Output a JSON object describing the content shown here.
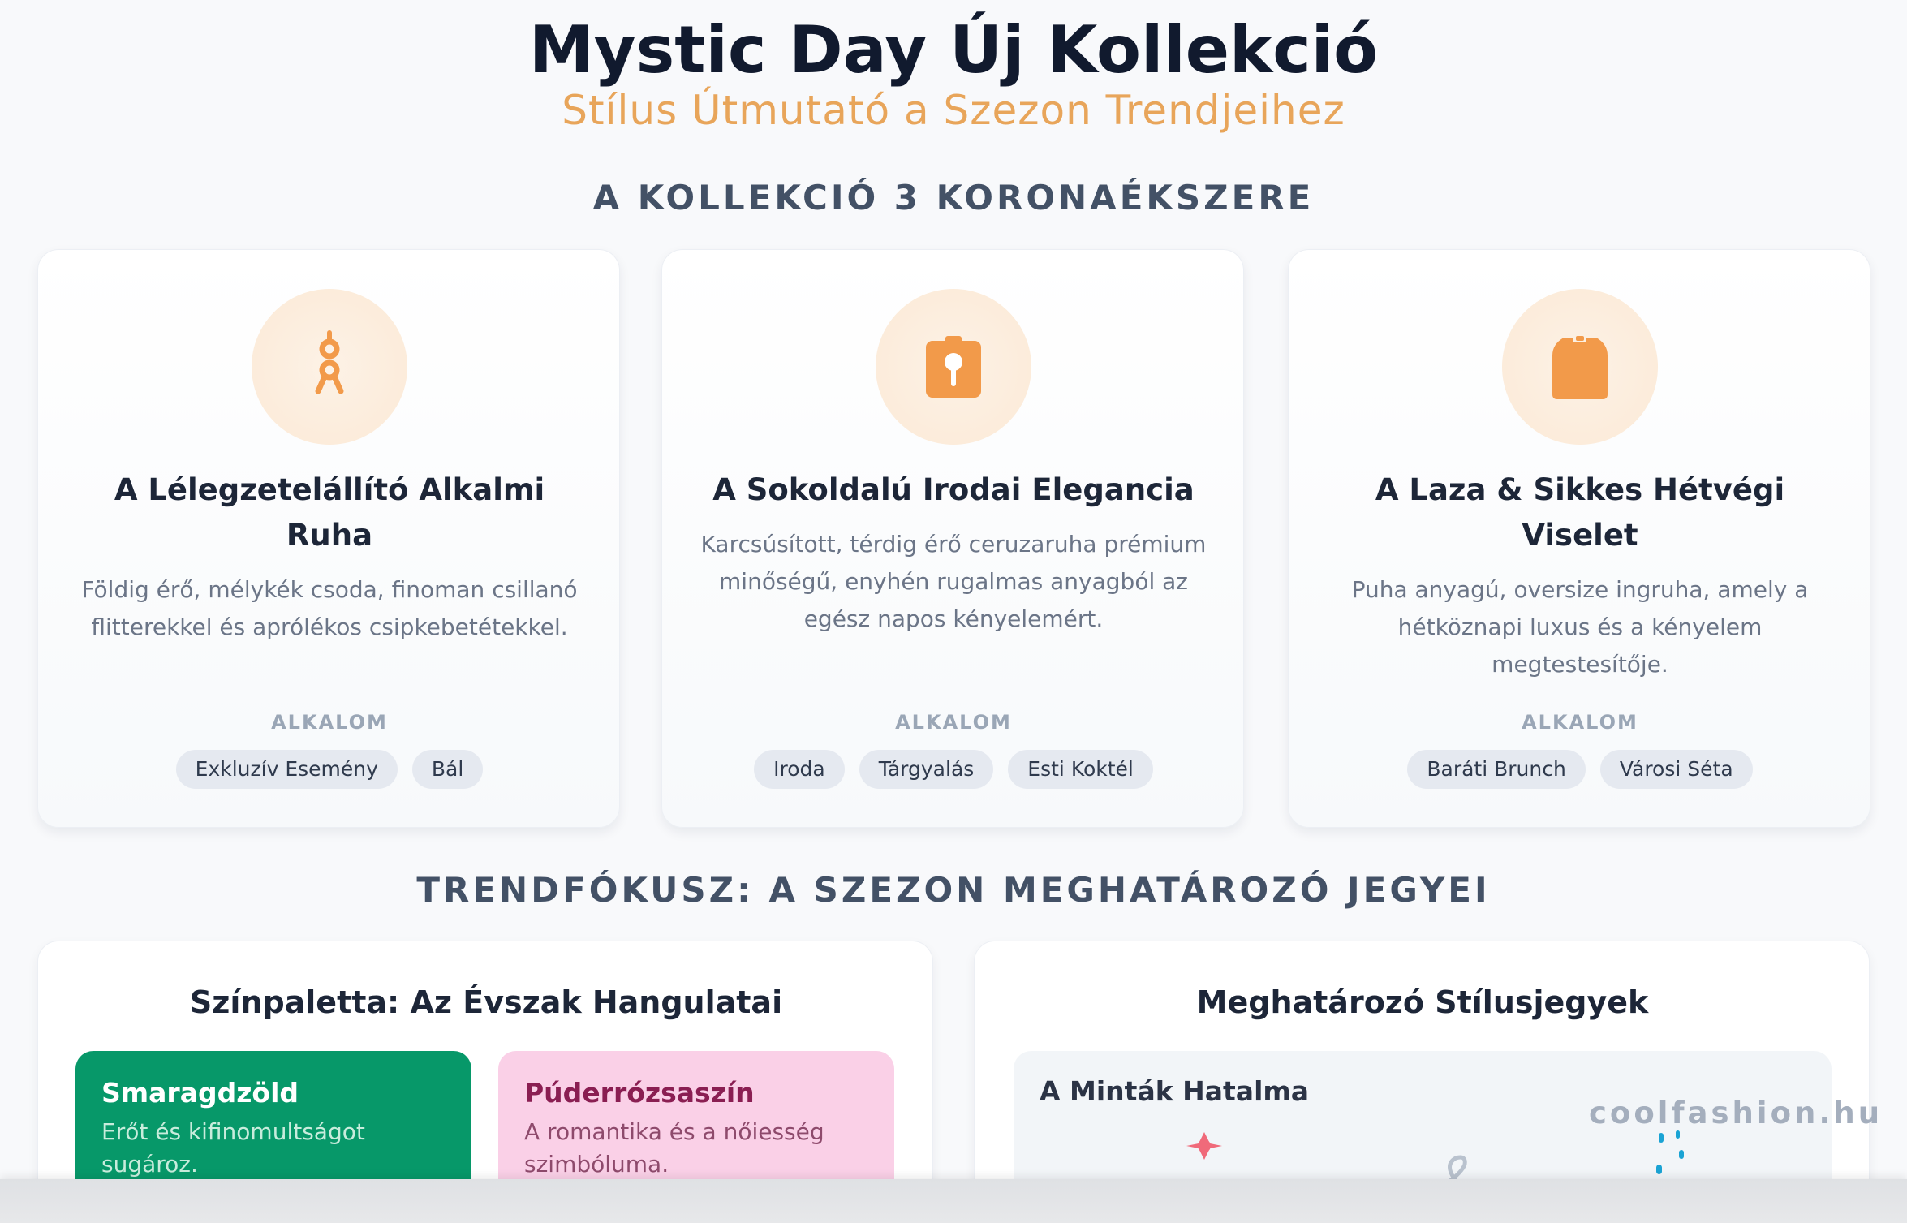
{
  "header": {
    "title": "Mystic Day Új Kollekció",
    "subtitle": "Stílus Útmutató a Szezon Trendjeihez"
  },
  "sections": {
    "collection_heading": "A KOLLEKCIÓ 3 KORONAÉKSZERE",
    "trend_heading": "TRENDFÓKUSZ: A SZEZON MEGHATÁROZÓ JEGYEI"
  },
  "cards": [
    {
      "icon": "dress-icon",
      "title": "A Lélegzetelállító Alkalmi Ruha",
      "description": "Földig érő, mélykék csoda, finoman csillanó flitterekkel és aprólékos csipkebetétekkel.",
      "occasion_label": "ALKALOM",
      "tags": [
        "Exkluzív Esemény",
        "Bál"
      ]
    },
    {
      "icon": "office-suit-icon",
      "title": "A Sokoldalú Irodai Elegancia",
      "description": "Karcsúsított, térdig érő ceruzaruha prémium minőségű, enyhén rugalmas anyagból az egész napos kényelemért.",
      "occasion_label": "ALKALOM",
      "tags": [
        "Iroda",
        "Tárgyalás",
        "Esti Koktél"
      ]
    },
    {
      "icon": "sweater-icon",
      "title": "A Laza & Sikkes Hétvégi Viselet",
      "description": "Puha anyagú, oversize ingruha, amely a hétköznapi luxus és a kényelem megtestesítője.",
      "occasion_label": "ALKALOM",
      "tags": [
        "Baráti Brunch",
        "Városi Séta"
      ]
    }
  ],
  "palette_panel": {
    "title": "Színpaletta: Az Évszak Hangulatai",
    "swatches": [
      {
        "name": "Smaragdzöld",
        "description": "Erőt és kifinomultságot sugároz.",
        "color": "#079869"
      },
      {
        "name": "Púderrózsaszín",
        "description": "A romantika és a nőiesség szimbóluma.",
        "color": "#fad0e7"
      }
    ]
  },
  "style_panel": {
    "title": "Meghatározó Stílusjegyek",
    "pattern_title": "A Minták Hatalma"
  },
  "watermark": "coolfashion.hu",
  "colors": {
    "accent_orange": "#f29a4a",
    "title_dark": "#111a2e",
    "subtitle_orange": "#e8a55a"
  }
}
